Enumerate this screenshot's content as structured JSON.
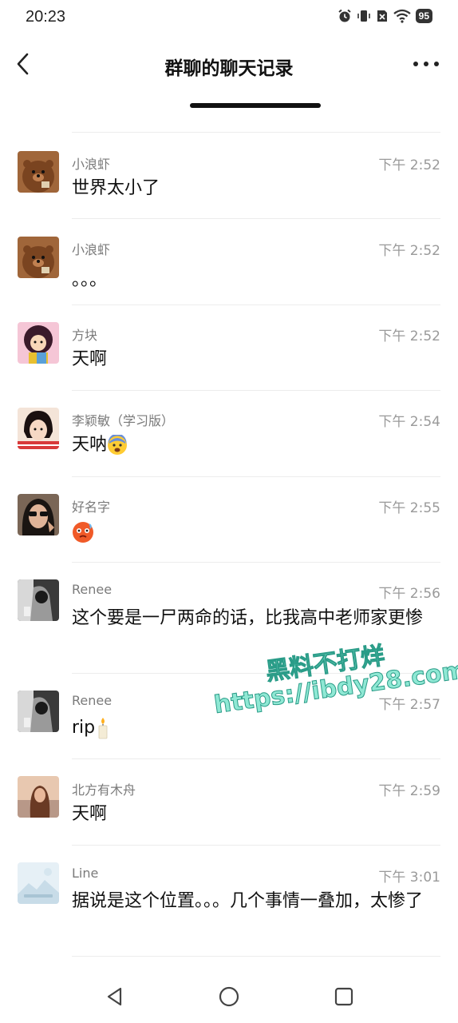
{
  "status_bar": {
    "time": "20:23",
    "battery": "95",
    "icons": [
      "alarm-icon",
      "vibrate-icon",
      "sim-off-icon",
      "wifi-icon",
      "battery-icon"
    ]
  },
  "header": {
    "title": "群聊的聊天记录",
    "back_icon": "chevron-left-icon",
    "more_icon": "more-dots-icon"
  },
  "messages": [
    {
      "sender": "小浪虾",
      "time": "下午 2:52",
      "text": "世界太小了",
      "avatar": "bear-avatar"
    },
    {
      "sender": "小浪虾",
      "time": "下午 2:52",
      "text": "。。。",
      "avatar": "bear-avatar"
    },
    {
      "sender": "方块",
      "time": "下午 2:52",
      "text": "天啊",
      "avatar": "girl-illustration-avatar"
    },
    {
      "sender": "李颖敏（学习版）",
      "time": "下午 2:54",
      "text": "天呐",
      "emoji": "fearful-face-emoji",
      "avatar": "anime-girl-avatar"
    },
    {
      "sender": "好名字",
      "time": "下午 2:55",
      "text": "",
      "emoji": "hot-face-emoji",
      "avatar": "sunglasses-woman-avatar"
    },
    {
      "sender": "Renee",
      "time": "下午 2:56",
      "text": "这个要是一尸两命的话，比我高中老师家更惨",
      "avatar": "bw-photo-avatar"
    },
    {
      "sender": "Renee",
      "time": "下午 2:57",
      "text": "rip",
      "emoji": "candle-emoji",
      "avatar": "bw-photo-avatar"
    },
    {
      "sender": "北方有木舟",
      "time": "下午 2:59",
      "text": "天啊",
      "avatar": "sunset-woman-avatar"
    },
    {
      "sender": "Line",
      "time": "下午 3:01",
      "text": "据说是这个位置。。。几个事情一叠加，太惨了",
      "avatar": "landscape-placeholder-avatar"
    }
  ],
  "watermark": {
    "line1": "黑料不打烊",
    "line2": "https://ibdy28.com"
  },
  "nav_bar": {
    "icons": [
      "back-triangle-icon",
      "home-circle-icon",
      "recents-square-icon"
    ]
  },
  "colors": {
    "text": "#111111",
    "sender": "#7a7a7a",
    "time": "#9a9a9a",
    "divider": "#ececec",
    "watermark": "#8fe8d4"
  }
}
